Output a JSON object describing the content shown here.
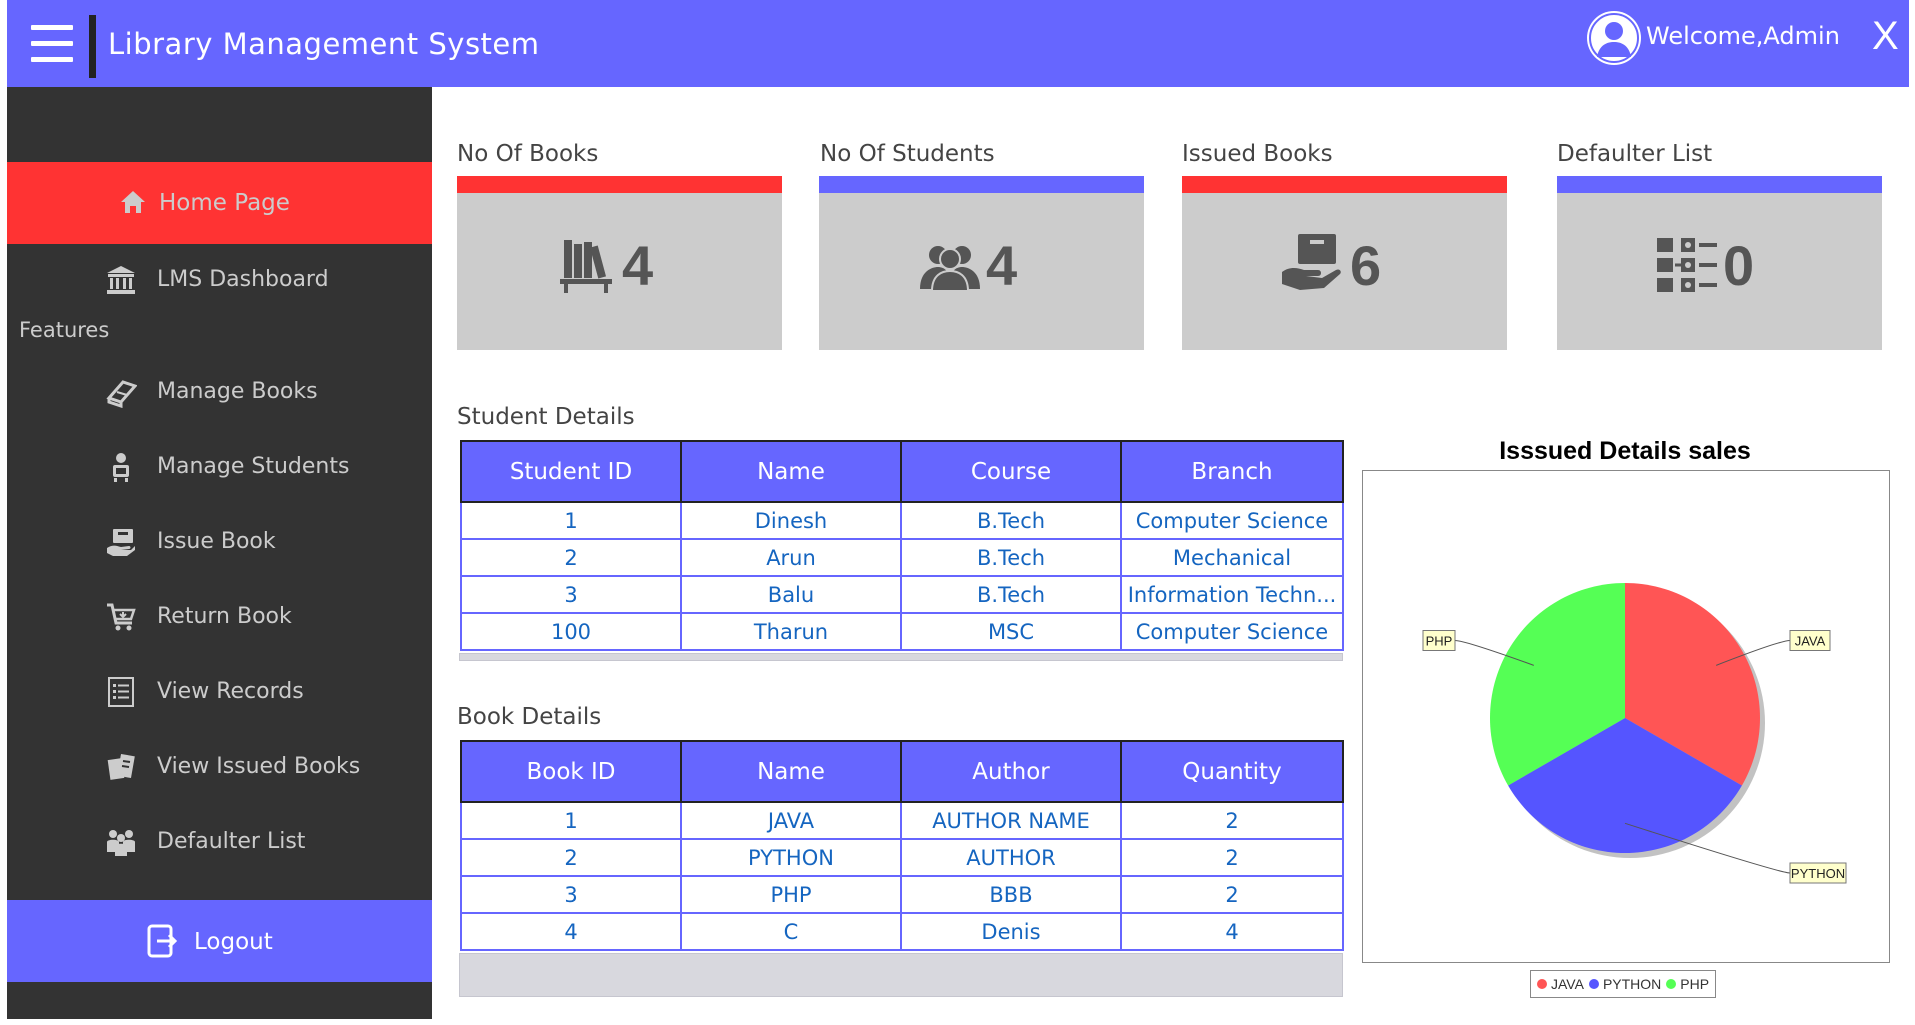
{
  "header": {
    "app_title": "Library Management System",
    "welcome_text": "Welcome,Admin",
    "close_label": "X"
  },
  "sidebar": {
    "home": "Home Page",
    "dashboard": "LMS Dashboard",
    "features_heading": "Features",
    "items": [
      {
        "label": "Manage Books",
        "icon": "book-icon"
      },
      {
        "label": "Manage Students",
        "icon": "student-icon"
      },
      {
        "label": "Issue Book",
        "icon": "issue-book-icon"
      },
      {
        "label": "Return Book",
        "icon": "return-cart-icon"
      },
      {
        "label": "View Records",
        "icon": "records-list-icon"
      },
      {
        "label": "View Issued Books",
        "icon": "issued-books-icon"
      },
      {
        "label": "Defaulter List",
        "icon": "defaulter-group-icon"
      }
    ],
    "logout": "Logout"
  },
  "cards": [
    {
      "title": "No Of Books",
      "value": "4",
      "bar_color": "#ff3333",
      "icon": "books-shelf-icon"
    },
    {
      "title": "No Of Students",
      "value": "4",
      "bar_color": "#6666ff",
      "icon": "students-group-icon"
    },
    {
      "title": "Issued Books",
      "value": "6",
      "bar_color": "#ff3333",
      "icon": "book-hand-icon"
    },
    {
      "title": "Defaulter List",
      "value": "0",
      "bar_color": "#6666ff",
      "icon": "list-images-icon"
    }
  ],
  "student_details": {
    "title": "Student Details",
    "columns": [
      "Student ID",
      "Name",
      "Course",
      "Branch"
    ],
    "rows": [
      [
        "1",
        "Dinesh",
        "B.Tech",
        "Computer Science"
      ],
      [
        "2",
        "Arun",
        "B.Tech",
        "Mechanical"
      ],
      [
        "3",
        "Balu",
        "B.Tech",
        "Information Techn..."
      ],
      [
        "100",
        "Tharun",
        "MSC",
        "Computer Science"
      ]
    ]
  },
  "book_details": {
    "title": "Book Details",
    "columns": [
      "Book ID",
      "Name",
      "Author",
      "Quantity"
    ],
    "rows": [
      [
        "1",
        "JAVA",
        "AUTHOR NAME",
        "2"
      ],
      [
        "2",
        "PYTHON",
        "AUTHOR",
        "2"
      ],
      [
        "3",
        "PHP",
        "BBB",
        "2"
      ],
      [
        "4",
        "C",
        "Denis",
        "4"
      ]
    ]
  },
  "chart_data": {
    "type": "pie",
    "title": "Isssued Details sales",
    "categories": [
      "JAVA",
      "PYTHON",
      "PHP"
    ],
    "values": [
      1,
      1,
      1
    ],
    "colors": [
      "#ff5555",
      "#5555ff",
      "#55ff55"
    ],
    "legend": [
      "JAVA",
      "PYTHON",
      "PHP"
    ],
    "legend_position": "bottom"
  }
}
